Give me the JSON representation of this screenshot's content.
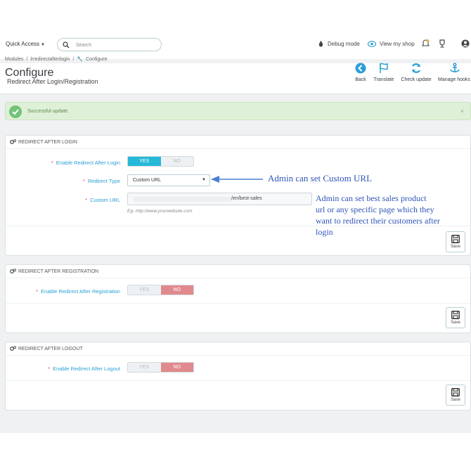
{
  "topbar": {
    "quick_access": "Quick Access",
    "search_placeholder": "Search",
    "debug_mode": "Debug mode",
    "view_my_shop": "View my shop"
  },
  "breadcrumb": {
    "items": [
      "Modules",
      "/",
      "lrredirectafterlogin",
      "/",
      "Configure"
    ]
  },
  "header": {
    "title": "Configure",
    "subtitle": "Redirect After Login/Registration",
    "toolbar": {
      "back": "Back",
      "translate": "Translate",
      "check_update": "Check update",
      "manage_hooks": "Manage hooks"
    }
  },
  "alert": {
    "message": "Successful update.",
    "close": "×"
  },
  "panels": {
    "login": {
      "title": "REDIRECT AFTER LOGIN",
      "enable_label": "Enable Redirect After Login",
      "yes": "YES",
      "no": "NO",
      "redirect_type_label": "Redirect Type",
      "redirect_type_value": "Custom URL",
      "custom_url_label": "Custom URL",
      "custom_url_value": "/en/best-sales",
      "custom_url_hint": "Eg- http://www.yourwebsite.com",
      "save": "Save"
    },
    "registration": {
      "title": "REDIRECT AFTER REGISTRATION",
      "enable_label": "Enable Redirect After Registration",
      "yes": "YES",
      "no": "NO",
      "save": "Save"
    },
    "logout": {
      "title": "REDIRECT AFTER LOGOUT",
      "enable_label": "Enable Redirect After Logout",
      "yes": "YES",
      "no": "NO",
      "save": "Save"
    }
  },
  "annotations": {
    "custom_url_note": "Admin can set Custom URL",
    "best_sales_note": [
      "Admin can set best sales product",
      "url or any specific page which they",
      "want to redirect their customers after",
      "login"
    ]
  },
  "colors": {
    "accent": "#25b9d7",
    "no_active": "#e08a8e",
    "success_bg": "#dff0d8",
    "annotation": "#2f55b8"
  }
}
